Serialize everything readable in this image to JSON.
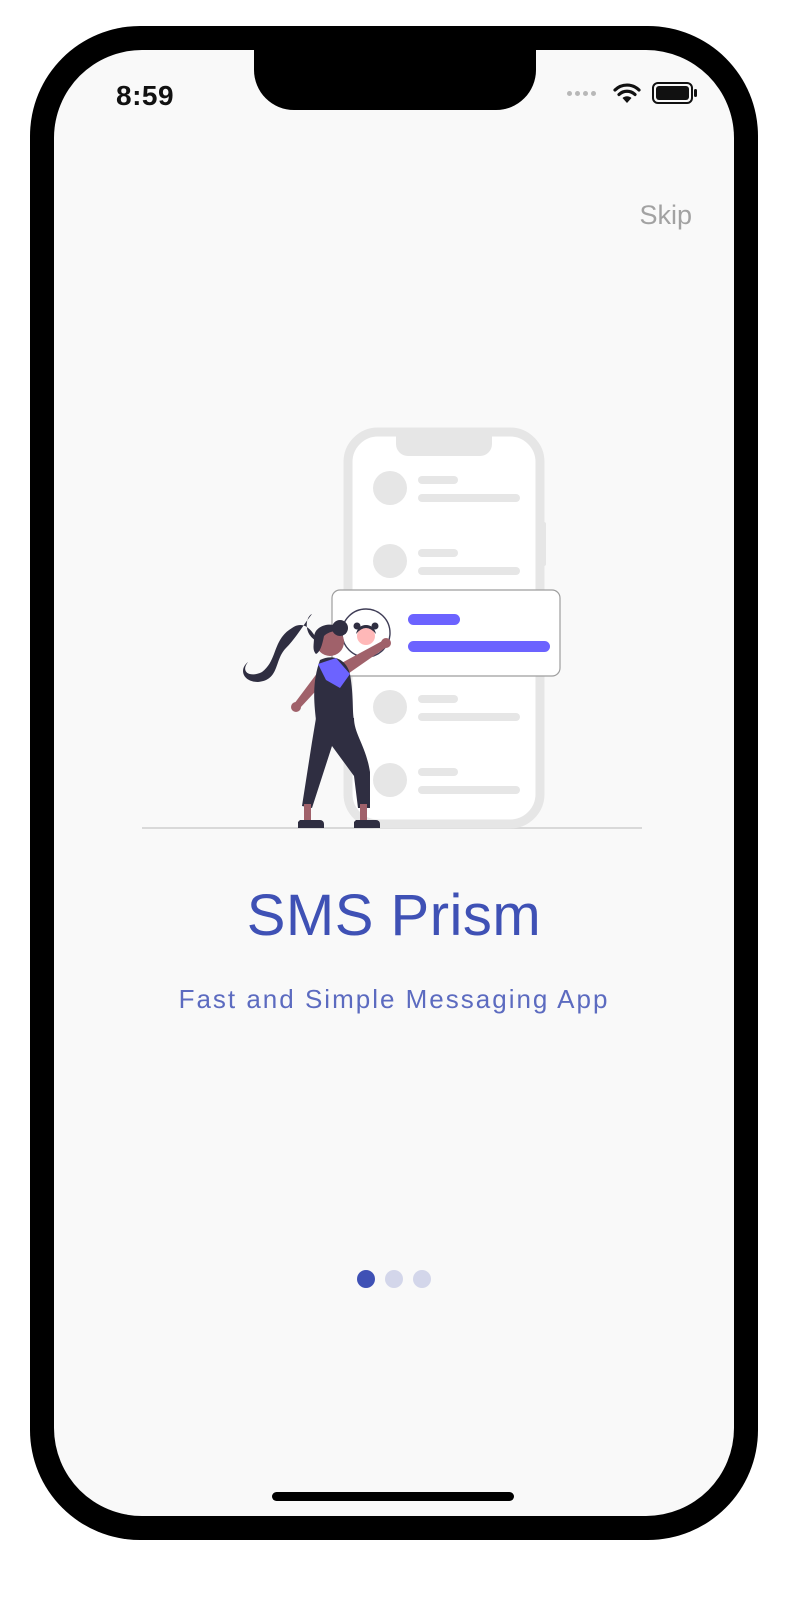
{
  "status_bar": {
    "time": "8:59"
  },
  "onboarding": {
    "skip_label": "Skip",
    "title": "SMS Prism",
    "subtitle": "Fast and Simple Messaging App",
    "pager": {
      "total": 3,
      "active_index": 0
    }
  },
  "colors": {
    "accent": "#3f51b5",
    "subtitle": "#5c6bc0",
    "illustration_accent": "#6c63ff",
    "background": "#f9f9f9"
  },
  "icons": [
    "wifi-icon",
    "battery-icon",
    "signal-icon"
  ]
}
